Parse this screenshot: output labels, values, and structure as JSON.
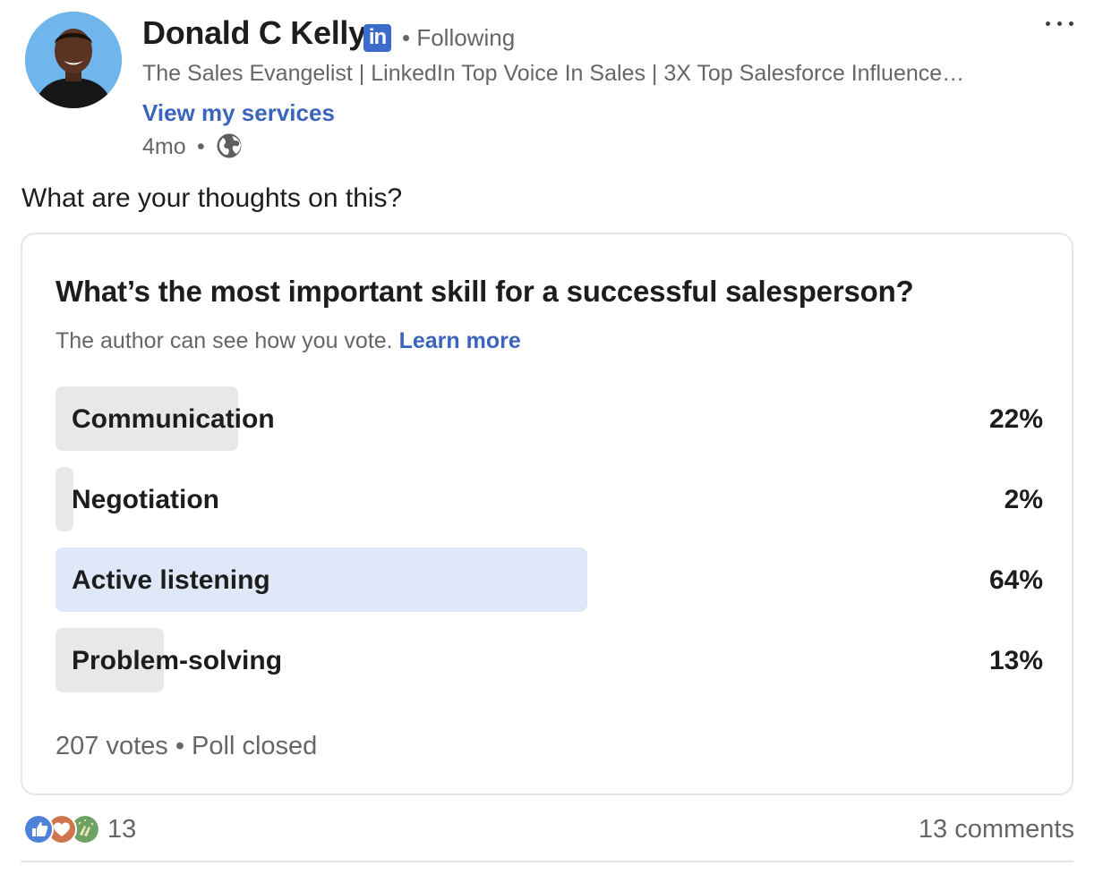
{
  "author": {
    "name": "Donald C Kelly",
    "badge": "in",
    "follow_status": "• Following",
    "headline": "The Sales Evangelist | LinkedIn Top Voice In Sales | 3X Top Salesforce Influence…",
    "services_link": "View my services",
    "posted_ago": "4mo",
    "separator": "•",
    "visibility_icon": "globe-icon",
    "avatar_icon": "avatar"
  },
  "post": {
    "commentary": "What are your thoughts on this?",
    "more_icon": "more-horizontal-icon"
  },
  "poll": {
    "question": "What’s the most important skill for a successful salesperson?",
    "note": "The author can see how you vote. ",
    "note_link": "Learn more",
    "options": [
      {
        "label": "Communication",
        "percent_label": "22%",
        "percent": 22
      },
      {
        "label": "Negotiation",
        "percent_label": "2%",
        "percent": 2
      },
      {
        "label": "Active listening",
        "percent_label": "64%",
        "percent": 64
      },
      {
        "label": "Problem-solving",
        "percent_label": "13%",
        "percent": 13
      }
    ],
    "footer": "207 votes • Poll closed"
  },
  "social": {
    "reaction_icons": [
      "like-icon",
      "love-icon",
      "celebrate-icon"
    ],
    "reaction_count": "13",
    "comments": "13 comments"
  },
  "colors": {
    "link_blue": "#3b65bd",
    "linkedin_blue": "#3b6bcb",
    "bar_gray": "#e8e8e8",
    "bar_selected": "#dfe8f9",
    "muted_text": "#666666"
  }
}
